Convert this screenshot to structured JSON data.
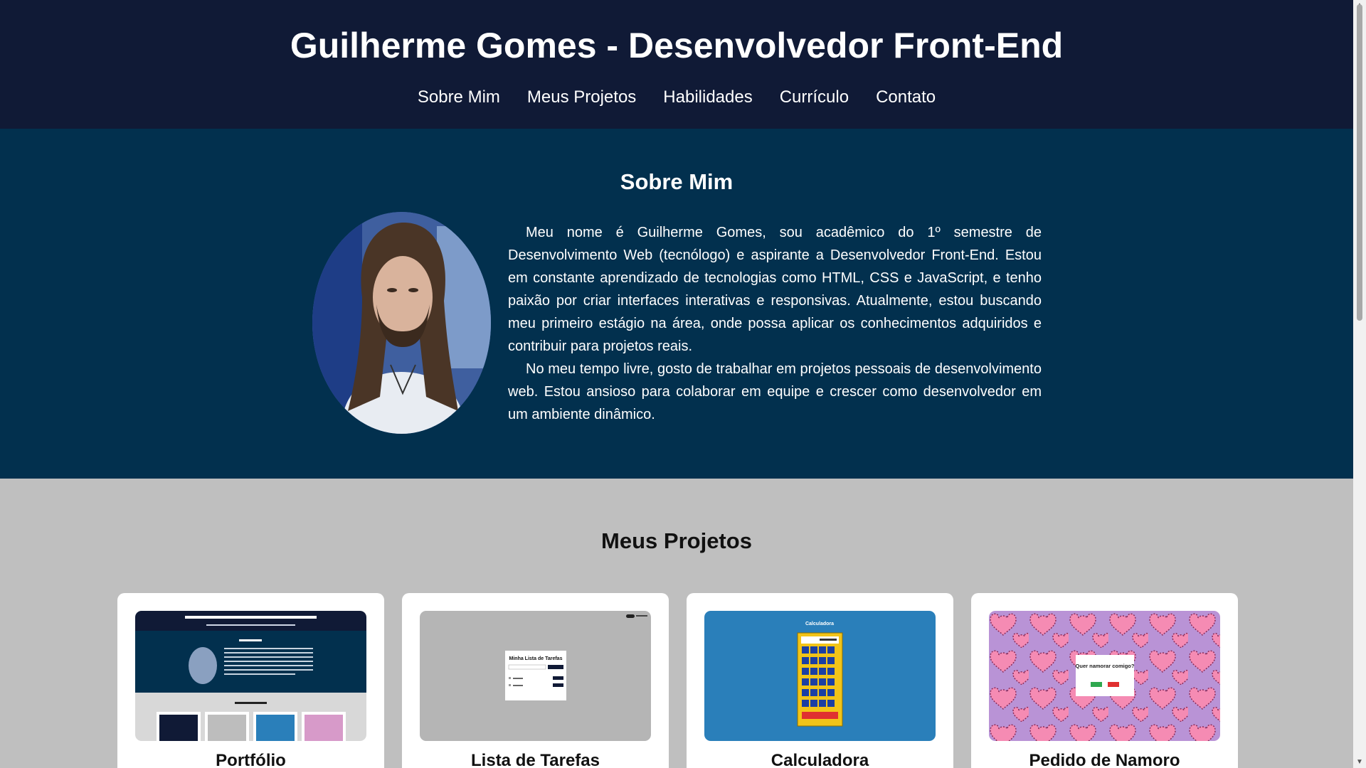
{
  "header": {
    "title": "Guilherme Gomes - Desenvolvedor Front-End",
    "nav": [
      "Sobre Mim",
      "Meus Projetos",
      "Habilidades",
      "Currículo",
      "Contato"
    ]
  },
  "about": {
    "heading": "Sobre Mim",
    "paragraphs": [
      "Meu nome é Guilherme Gomes, sou acadêmico do 1º semestre de Desenvolvimento Web (tecnólogo) e aspirante a Desenvolvedor Front-End. Estou em constante aprendizado de tecnologias como HTML, CSS e JavaScript, e tenho paixão por criar interfaces interativas e responsivas. Atualmente, estou buscando meu primeiro estágio na área, onde possa aplicar os conhecimentos adquiridos e contribuir para projetos reais.",
      "No meu tempo livre, gosto de trabalhar em projetos pessoais de desenvolvimento web. Estou ansioso para colaborar em equipe e crescer como desenvolvedor em um ambiente dinâmico."
    ]
  },
  "projects": {
    "heading": "Meus Projetos",
    "items": [
      {
        "title": "Portfólio"
      },
      {
        "title": "Lista de Tarefas",
        "thumb_heading": "Minha Lista de Tarefas"
      },
      {
        "title": "Calculadora",
        "thumb_heading": "Calculadora"
      },
      {
        "title": "Pedido de Namoro",
        "thumb_heading": "Quer namorar comigo?"
      }
    ]
  },
  "colors": {
    "header_bg": "#101a36",
    "about_bg": "#02304e",
    "projects_bg": "#bfbfbf",
    "calc_bg": "#2a7fba",
    "calc_body": "#f2c418",
    "love_bg": "#b993d6",
    "heart": "#f58bb3"
  }
}
